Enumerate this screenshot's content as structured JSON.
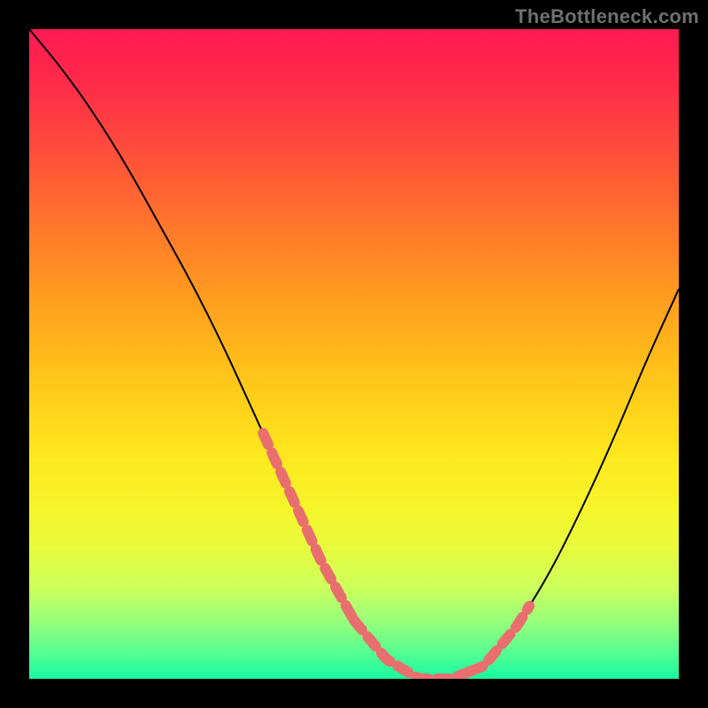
{
  "watermark": "TheBottleneck.com",
  "colors": {
    "gradient_top": "#ff1a52",
    "gradient_bottom": "#18f7a2",
    "curve": "#000000",
    "overlay": "#e96f6e",
    "frame": "#000000"
  },
  "chart_data": {
    "type": "line",
    "title": "",
    "xlabel": "",
    "ylabel": "",
    "xlim": [
      0,
      100
    ],
    "ylim": [
      0,
      100
    ],
    "series": [
      {
        "name": "bottleneck-curve",
        "x": [
          0,
          5,
          10,
          15,
          20,
          25,
          30,
          35,
          40,
          45,
          50,
          55,
          60,
          65,
          70,
          75,
          80,
          85,
          90,
          95,
          100
        ],
        "values": [
          100,
          94,
          87,
          79,
          70,
          61,
          51,
          40,
          29,
          18,
          9,
          3,
          0,
          0,
          2,
          8,
          16,
          26,
          37,
          49,
          60
        ]
      }
    ],
    "annotations": [
      {
        "name": "highlight-left-descent",
        "x_range": [
          36,
          50
        ],
        "note": "pink dashed overlay on left slope near trough"
      },
      {
        "name": "highlight-trough",
        "x_range": [
          50,
          68
        ],
        "note": "pink dashed overlay across valley floor"
      },
      {
        "name": "highlight-right-ascent",
        "x_range": [
          68,
          77
        ],
        "note": "pink dashed overlay on right slope leaving trough"
      }
    ]
  }
}
